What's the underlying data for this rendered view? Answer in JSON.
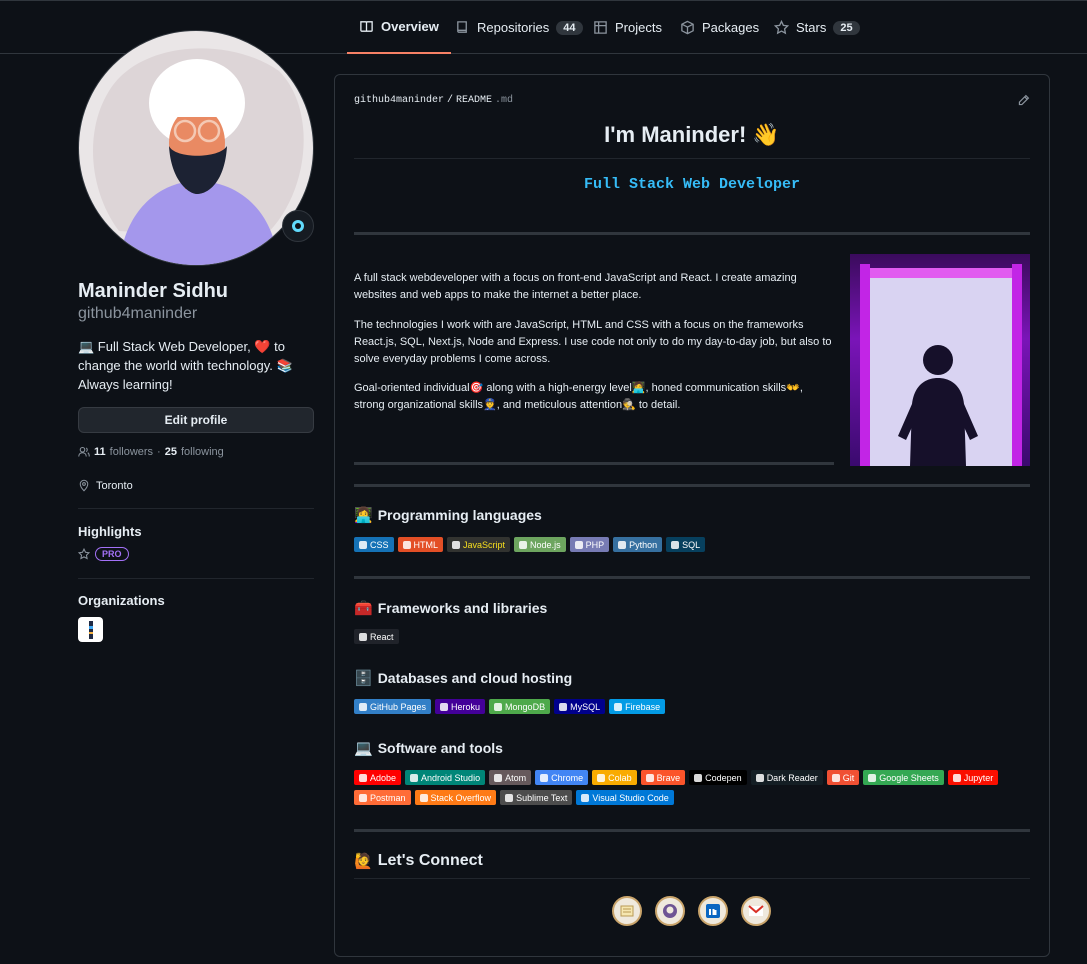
{
  "tabs": [
    {
      "label": "Overview",
      "count": ""
    },
    {
      "label": "Repositories",
      "count": "44"
    },
    {
      "label": "Projects",
      "count": ""
    },
    {
      "label": "Packages",
      "count": ""
    },
    {
      "label": "Stars",
      "count": "25"
    }
  ],
  "profile": {
    "name": "Maninder Sidhu",
    "login": "github4maninder",
    "bio": "💻 Full Stack Web Developer, ❤️ to change the world with technology. 📚 Always learning!",
    "edit_label": "Edit profile",
    "followers_count": "11",
    "followers_label": "followers",
    "separator": "·",
    "following_count": "25",
    "following_label": "following",
    "location": "Toronto",
    "highlights_title": "Highlights",
    "pro_label": "PRO",
    "organizations_title": "Organizations"
  },
  "readme": {
    "path_user": "github4maninder",
    "path_sep": "/",
    "path_file": "README",
    "path_ext": ".md",
    "heading": "I'm Maninder! 👋",
    "typing": "Full Stack Web Developer",
    "paragraphs": [
      "A full stack webdeveloper with a focus on front-end JavaScript and React. I create amazing websites and web apps to make the internet a better place.",
      "The technologies I work with are JavaScript, HTML and CSS with a focus on the frameworks React.js, SQL, Next.js, Node and Express. I use code not only to do my day-to-day job, but also to solve everyday problems I come across.",
      "Goal-oriented individual🎯 along with a high-energy level🧑‍💻, honed communication skills👐, strong organizational skills👮, and meticulous attention🕵️ to detail."
    ],
    "sections": [
      {
        "emoji": "👩‍💻",
        "title": "Programming languages",
        "badges": [
          {
            "label": "CSS",
            "color": "#1572b6"
          },
          {
            "label": "HTML",
            "color": "#e34f26"
          },
          {
            "label": "JavaScript",
            "color": "#323330",
            "text": "#f7df1e"
          },
          {
            "label": "Node.js",
            "color": "#6da55f"
          },
          {
            "label": "PHP",
            "color": "#777bb4"
          },
          {
            "label": "Python",
            "color": "#3670a0"
          },
          {
            "label": "SQL",
            "color": "#07405e"
          }
        ]
      },
      {
        "emoji": "🧰",
        "title": "Frameworks and libraries",
        "badges": [
          {
            "label": "React",
            "color": "#20232a"
          }
        ]
      },
      {
        "emoji": "🗄️",
        "title": "Databases and cloud hosting",
        "badges": [
          {
            "label": "GitHub Pages",
            "color": "#327fc7"
          },
          {
            "label": "Heroku",
            "color": "#430098"
          },
          {
            "label": "MongoDB",
            "color": "#4ea94b"
          },
          {
            "label": "MySQL",
            "color": "#00008b"
          },
          {
            "label": "Firebase",
            "color": "#039be5"
          }
        ]
      },
      {
        "emoji": "💻",
        "title": "Software and tools",
        "badges": [
          {
            "label": "Adobe",
            "color": "#ff0000"
          },
          {
            "label": "Android Studio",
            "color": "#008678"
          },
          {
            "label": "Atom",
            "color": "#66595c"
          },
          {
            "label": "Chrome",
            "color": "#4285f4"
          },
          {
            "label": "Colab",
            "color": "#f9ab00"
          },
          {
            "label": "Brave",
            "color": "#fb542b"
          },
          {
            "label": "Codepen",
            "color": "#000000"
          },
          {
            "label": "Dark Reader",
            "color": "#141e24"
          },
          {
            "label": "Git",
            "color": "#f05033"
          },
          {
            "label": "Google Sheets",
            "color": "#34a853"
          },
          {
            "label": "Jupyter",
            "color": "#fa0f00"
          },
          {
            "label": "Postman",
            "color": "#ff6c37"
          },
          {
            "label": "Stack Overflow",
            "color": "#fe7a16"
          },
          {
            "label": "Sublime Text",
            "color": "#4c4c4c"
          },
          {
            "label": "Visual Studio Code",
            "color": "#0078d7"
          }
        ]
      }
    ],
    "connect_title": "Let's Connect",
    "connect_emoji": "🙋",
    "connect_icons": [
      "portfolio-icon",
      "github-icon",
      "linkedin-icon",
      "gmail-icon"
    ]
  }
}
